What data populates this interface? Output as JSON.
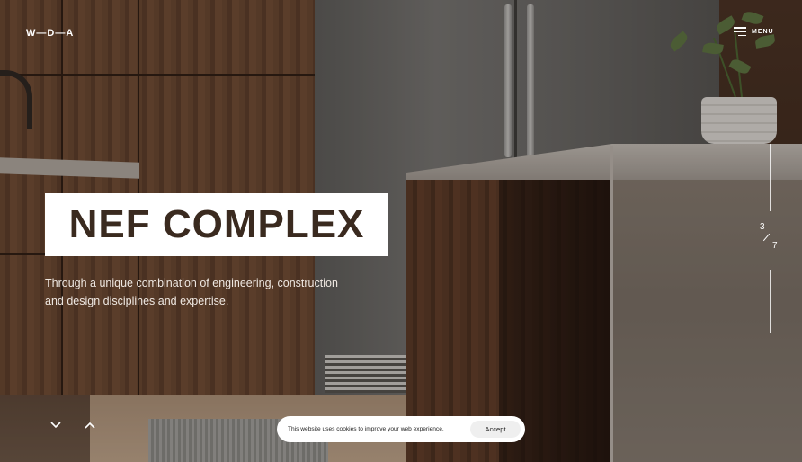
{
  "brand": {
    "logo": "W—D—A"
  },
  "nav": {
    "menu_label": "MENU"
  },
  "hero": {
    "title": "NEF COMPLEX",
    "subtitle": "Through a unique combination of engineering, construction and design disciplines and expertise."
  },
  "slider": {
    "current": "3",
    "total": "7"
  },
  "controls": {
    "prev_icon": "chevron-down-icon",
    "next_icon": "chevron-up-icon"
  },
  "cookie": {
    "message": "This website uses cookies to improve your web experience.",
    "accept_label": "Accept"
  },
  "colors": {
    "title_text": "#3a2a1f",
    "title_box": "#ffffff",
    "ui_text": "#ffffff"
  }
}
